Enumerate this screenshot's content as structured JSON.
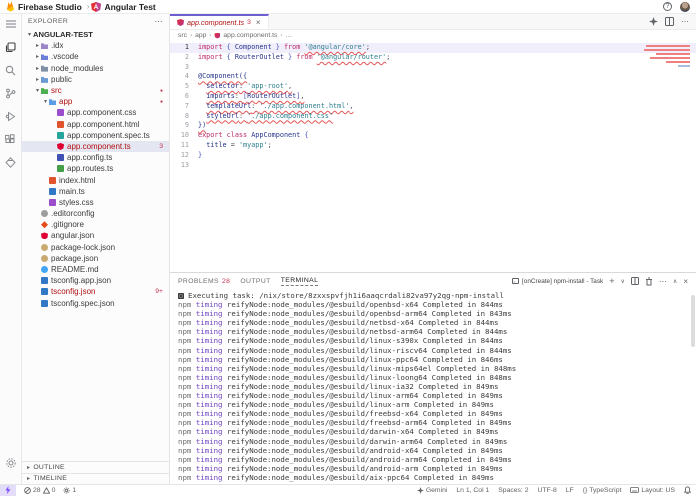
{
  "titlebar": {
    "app_name": "Firebase Studio",
    "separator": "›",
    "project_name": "Angular Test"
  },
  "explorer": {
    "header": "EXPLORER",
    "header_more": "⋯",
    "items": [
      {
        "label": "ANGULAR-TEST",
        "indent": 0,
        "chevron": "▾",
        "bold": true
      },
      {
        "label": ".idx",
        "indent": 1,
        "chevron": "▸",
        "icon": "folder",
        "color": "#9a86c8"
      },
      {
        "label": ".vscode",
        "indent": 1,
        "chevron": "▸",
        "icon": "folder",
        "color": "#6b7fd7"
      },
      {
        "label": "node_modules",
        "indent": 1,
        "chevron": "▸",
        "icon": "folder",
        "color": "#7f8fa6"
      },
      {
        "label": "public",
        "indent": 1,
        "chevron": "▸",
        "icon": "folder",
        "color": "#6b9bd2"
      },
      {
        "label": "src",
        "indent": 1,
        "chevron": "▾",
        "icon": "folder",
        "color": "#4caf50",
        "red": true,
        "badge": "●",
        "dot": true
      },
      {
        "label": "app",
        "indent": 2,
        "chevron": "▾",
        "icon": "folder",
        "color": "#5c9ce6",
        "red": true,
        "badge": "●",
        "dot": true
      },
      {
        "label": "app.component.css",
        "indent": 3,
        "icon": "file",
        "color": "#9c4dcc"
      },
      {
        "label": "app.component.html",
        "indent": 3,
        "icon": "file",
        "color": "#e0532f"
      },
      {
        "label": "app.component.spec.ts",
        "indent": 3,
        "icon": "file",
        "color": "#26a69a"
      },
      {
        "label": "app.component.ts",
        "indent": 3,
        "icon": "angular",
        "color": "#dd0031",
        "red": true,
        "badge": "3",
        "selected": true
      },
      {
        "label": "app.config.ts",
        "indent": 3,
        "icon": "file",
        "color": "#3f51b5"
      },
      {
        "label": "app.routes.ts",
        "indent": 3,
        "icon": "file",
        "color": "#43a047"
      },
      {
        "label": "index.html",
        "indent": 2,
        "icon": "file",
        "color": "#e0532f"
      },
      {
        "label": "main.ts",
        "indent": 2,
        "icon": "file",
        "color": "#3178c6"
      },
      {
        "label": "styles.css",
        "indent": 2,
        "icon": "file",
        "color": "#9c4dcc"
      },
      {
        "label": ".editorconfig",
        "indent": 1,
        "icon": "circle",
        "color": "#9e9e9e"
      },
      {
        "label": ".gitignore",
        "indent": 1,
        "icon": "diamond",
        "color": "#e64a19"
      },
      {
        "label": "angular.json",
        "indent": 1,
        "icon": "angular",
        "color": "#dd0031"
      },
      {
        "label": "package-lock.json",
        "indent": 1,
        "icon": "circle",
        "color": "#c9ab71"
      },
      {
        "label": "package.json",
        "indent": 1,
        "icon": "circle",
        "color": "#c9ab71"
      },
      {
        "label": "README.md",
        "indent": 1,
        "icon": "circle",
        "color": "#42a5f5"
      },
      {
        "label": "tsconfig.app.json",
        "indent": 1,
        "icon": "file",
        "color": "#3178c6"
      },
      {
        "label": "tsconfig.json",
        "indent": 1,
        "icon": "file",
        "color": "#3178c6",
        "red": true,
        "badge": "9+"
      },
      {
        "label": "tsconfig.spec.json",
        "indent": 1,
        "icon": "file",
        "color": "#3178c6"
      }
    ],
    "bottom_sections": [
      {
        "label": "OUTLINE"
      },
      {
        "label": "TIMELINE"
      }
    ]
  },
  "editor": {
    "tab": {
      "label": "app.component.ts",
      "problem_count": "3",
      "close": "×"
    },
    "breadcrumb": {
      "parts": [
        "src",
        "app",
        "app.component.ts",
        "…"
      ]
    },
    "code": {
      "lines": [
        {
          "n": "1",
          "hl": true,
          "segs": [
            [
              "import",
              "k"
            ],
            [
              " ",
              "t"
            ],
            [
              "{",
              "b"
            ],
            [
              " Component ",
              "i"
            ],
            [
              "}",
              "b"
            ],
            [
              " ",
              "t"
            ],
            [
              "from",
              "k"
            ],
            [
              " ",
              "t"
            ],
            [
              "'@angular/core'",
              "s e"
            ],
            [
              ";",
              "p"
            ]
          ]
        },
        {
          "n": "2",
          "segs": [
            [
              "import",
              "k"
            ],
            [
              " ",
              "t"
            ],
            [
              "{",
              "b"
            ],
            [
              " RouterOutlet ",
              "i"
            ],
            [
              "}",
              "b"
            ],
            [
              " ",
              "t"
            ],
            [
              "from",
              "k"
            ],
            [
              " ",
              "t"
            ],
            [
              "'@angular/router'",
              "s e"
            ],
            [
              ";",
              "p"
            ]
          ]
        },
        {
          "n": "3",
          "segs": []
        },
        {
          "n": "4",
          "segs": [
            [
              "@Component({",
              "d e"
            ]
          ]
        },
        {
          "n": "5",
          "segs": [
            [
              "  ",
              "t"
            ],
            [
              "selector",
              "i e"
            ],
            [
              ": ",
              "p e"
            ],
            [
              "'app-root'",
              "s e"
            ],
            [
              ",",
              "p e"
            ]
          ]
        },
        {
          "n": "6",
          "segs": [
            [
              "  ",
              "t"
            ],
            [
              "imports",
              "i e"
            ],
            [
              ": ",
              "p e"
            ],
            [
              "[",
              "b e"
            ],
            [
              "RouterOutlet",
              "i e"
            ],
            [
              "]",
              "b e"
            ],
            [
              ",",
              "p e"
            ]
          ]
        },
        {
          "n": "7",
          "segs": [
            [
              "  ",
              "t"
            ],
            [
              "templateUrl",
              "i e"
            ],
            [
              ": ",
              "p e"
            ],
            [
              "'./app.component.html'",
              "s e"
            ],
            [
              ",",
              "p e"
            ]
          ]
        },
        {
          "n": "8",
          "segs": [
            [
              "  ",
              "t"
            ],
            [
              "styleUrl",
              "i e"
            ],
            [
              ": ",
              "p e"
            ],
            [
              "'./app.component.css'",
              "s e"
            ]
          ]
        },
        {
          "n": "9",
          "segs": [
            [
              "})",
              "d e"
            ]
          ]
        },
        {
          "n": "10",
          "segs": [
            [
              "export",
              "k"
            ],
            [
              " ",
              "t"
            ],
            [
              "class",
              "k"
            ],
            [
              " ",
              "t"
            ],
            [
              "AppComponent",
              "i"
            ],
            [
              " ",
              "t"
            ],
            [
              "{",
              "b"
            ]
          ]
        },
        {
          "n": "11",
          "segs": [
            [
              "  ",
              "t"
            ],
            [
              "title",
              "i"
            ],
            [
              " ",
              "t"
            ],
            [
              "=",
              "p"
            ],
            [
              " ",
              "t"
            ],
            [
              "'myapp'",
              "s"
            ],
            [
              ";",
              "p"
            ]
          ]
        },
        {
          "n": "12",
          "segs": [
            [
              "}",
              "b"
            ]
          ]
        },
        {
          "n": "13",
          "segs": []
        }
      ]
    }
  },
  "panel": {
    "tabs": {
      "problems": "PROBLEMS",
      "problems_count": "28",
      "output": "OUTPUT",
      "terminal": "TERMINAL"
    },
    "task_label": "[onCreate] npm-install - Task",
    "terminal": {
      "exec_line": "Executing task: /nix/store/8zxxspvfjh1i6aaqcrdali82va97y2qg-npm-install",
      "lines": [
        "npm timing reifyNode:node_modules/@esbuild/openbsd-x64 Completed in 844ms",
        "npm timing reifyNode:node_modules/@esbuild/openbsd-arm64 Completed in 843ms",
        "npm timing reifyNode:node_modules/@esbuild/netbsd-x64 Completed in 844ms",
        "npm timing reifyNode:node_modules/@esbuild/netbsd-arm64 Completed in 844ms",
        "npm timing reifyNode:node_modules/@esbuild/linux-s390x Completed in 844ms",
        "npm timing reifyNode:node_modules/@esbuild/linux-riscv64 Completed in 844ms",
        "npm timing reifyNode:node_modules/@esbuild/linux-ppc64 Completed in 846ms",
        "npm timing reifyNode:node_modules/@esbuild/linux-mips64el Completed in 848ms",
        "npm timing reifyNode:node_modules/@esbuild/linux-loong64 Completed in 848ms",
        "npm timing reifyNode:node_modules/@esbuild/linux-ia32 Completed in 849ms",
        "npm timing reifyNode:node_modules/@esbuild/linux-arm64 Completed in 849ms",
        "npm timing reifyNode:node_modules/@esbuild/linux-arm Completed in 849ms",
        "npm timing reifyNode:node_modules/@esbuild/freebsd-x64 Completed in 849ms",
        "npm timing reifyNode:node_modules/@esbuild/freebsd-arm64 Completed in 849ms",
        "npm timing reifyNode:node_modules/@esbuild/darwin-x64 Completed in 849ms",
        "npm timing reifyNode:node_modules/@esbuild/darwin-arm64 Completed in 849ms",
        "npm timing reifyNode:node_modules/@esbuild/android-x64 Completed in 849ms",
        "npm timing reifyNode:node_modules/@esbuild/android-arm64 Completed in 849ms",
        "npm timing reifyNode:node_modules/@esbuild/android-arm Completed in 849ms",
        "npm timing reifyNode:node_modules/@esbuild/aix-ppc64 Completed in 849ms"
      ]
    }
  },
  "statusbar": {
    "errors": "28",
    "warnings": "0",
    "tasks": "1",
    "gemini": "Gemini",
    "cursor": "Ln 1, Col 1",
    "spaces": "Spaces: 2",
    "encoding": "UTF-8",
    "eol": "LF",
    "braces": "{}",
    "language": "TypeScript",
    "layout": "Layout: US"
  },
  "colors": {
    "accent": "#6d5fd0",
    "error": "#b01011",
    "firebase_orange": "#ff9100",
    "angular_red": "#dd0031"
  }
}
